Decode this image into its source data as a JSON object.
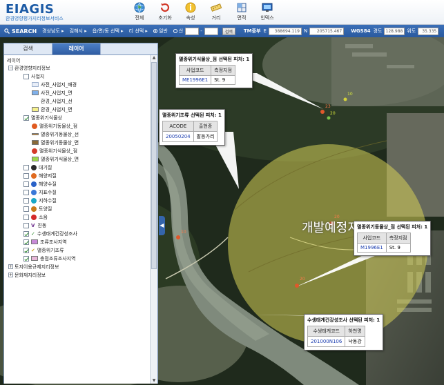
{
  "app": {
    "logo": "EIAGIS",
    "subtitle": "환경영향평가지리정보서비스"
  },
  "toolbar": [
    {
      "label": "전체",
      "icon": "globe-icon"
    },
    {
      "label": "초기화",
      "icon": "reset-icon"
    },
    {
      "label": "속성",
      "icon": "info-icon"
    },
    {
      "label": "거리",
      "icon": "ruler-icon"
    },
    {
      "label": "면적",
      "icon": "area-icon"
    },
    {
      "label": "인덱스",
      "icon": "monitor-icon"
    }
  ],
  "search": {
    "label": "SEARCH",
    "province": "경상남도",
    "city": "김해시",
    "town": "읍/면/동 선택",
    "village": "리 선택",
    "radio1": "일반",
    "radio2": "산",
    "go": "검색",
    "tm_label": "TM중부",
    "e_label": "E",
    "e_value": "388694.119",
    "n_label": "N",
    "n_value": "205715.467",
    "wgs_label": "WGS84",
    "lon_label": "경도",
    "lon_value": "128.988",
    "lat_label": "위도",
    "lat_value": "35.335"
  },
  "panel": {
    "tabs": [
      "검색",
      "레이어"
    ],
    "tree_title": "레이어",
    "root": "환경영향지리정보",
    "items": {
      "i1": "사업지",
      "i2": "사전_사업지_배경",
      "i3": "사전_사업지_면",
      "i4": "환경_사업지_선",
      "i5": "환경_사업지_면",
      "i6": "멸종위기식물상",
      "i7": "멸종위기동물상_점",
      "i8": "멸종위기동물상_선",
      "i9": "멸종위기동물상_면",
      "i10": "멸종위기식물상_점",
      "i11": "멸종위기식물상_면",
      "i12": "대기질",
      "i13": "해양저질",
      "i14": "해양수질",
      "i15": "지표수질",
      "i16": "지하수질",
      "i17": "토양질",
      "i18": "소음",
      "i19": "진동",
      "i20": "수생태계건강성조사",
      "i21": "조류조사지역",
      "i22": "멸종위기조류",
      "i23": "충점조류조사지역",
      "i24": "토지이용규제지리정보",
      "i25": "문화재지리정보"
    }
  },
  "map": {
    "dev_label": "개발예정지",
    "markers": [
      "23",
      "20",
      "20",
      "10",
      "20",
      "10"
    ]
  },
  "callouts": {
    "c1": {
      "title": "멸종위기식물상_점 선택된 피처: 1",
      "h1": "사업코드",
      "h2": "측정지점",
      "v1": "ME1996E1",
      "v2": "St. 9"
    },
    "c2": {
      "title": "멸종위기조류 선택된 피처: 1",
      "h1": "ACODE",
      "h2": "출현종",
      "v1": "20050204",
      "v2": "팔등가리"
    },
    "c3": {
      "title": "멸종위기동물상_점 선택된 피처: 1",
      "h1": "사업코드",
      "h2": "측정지점",
      "v1": "M1996E1",
      "v2": "St. 9"
    },
    "c4": {
      "title": "수생태계건강성조사 선택된 피처: 1",
      "h1": "수생태계코드",
      "h2": "하천명",
      "v1": "201000N106",
      "v2": "낙동강"
    }
  }
}
